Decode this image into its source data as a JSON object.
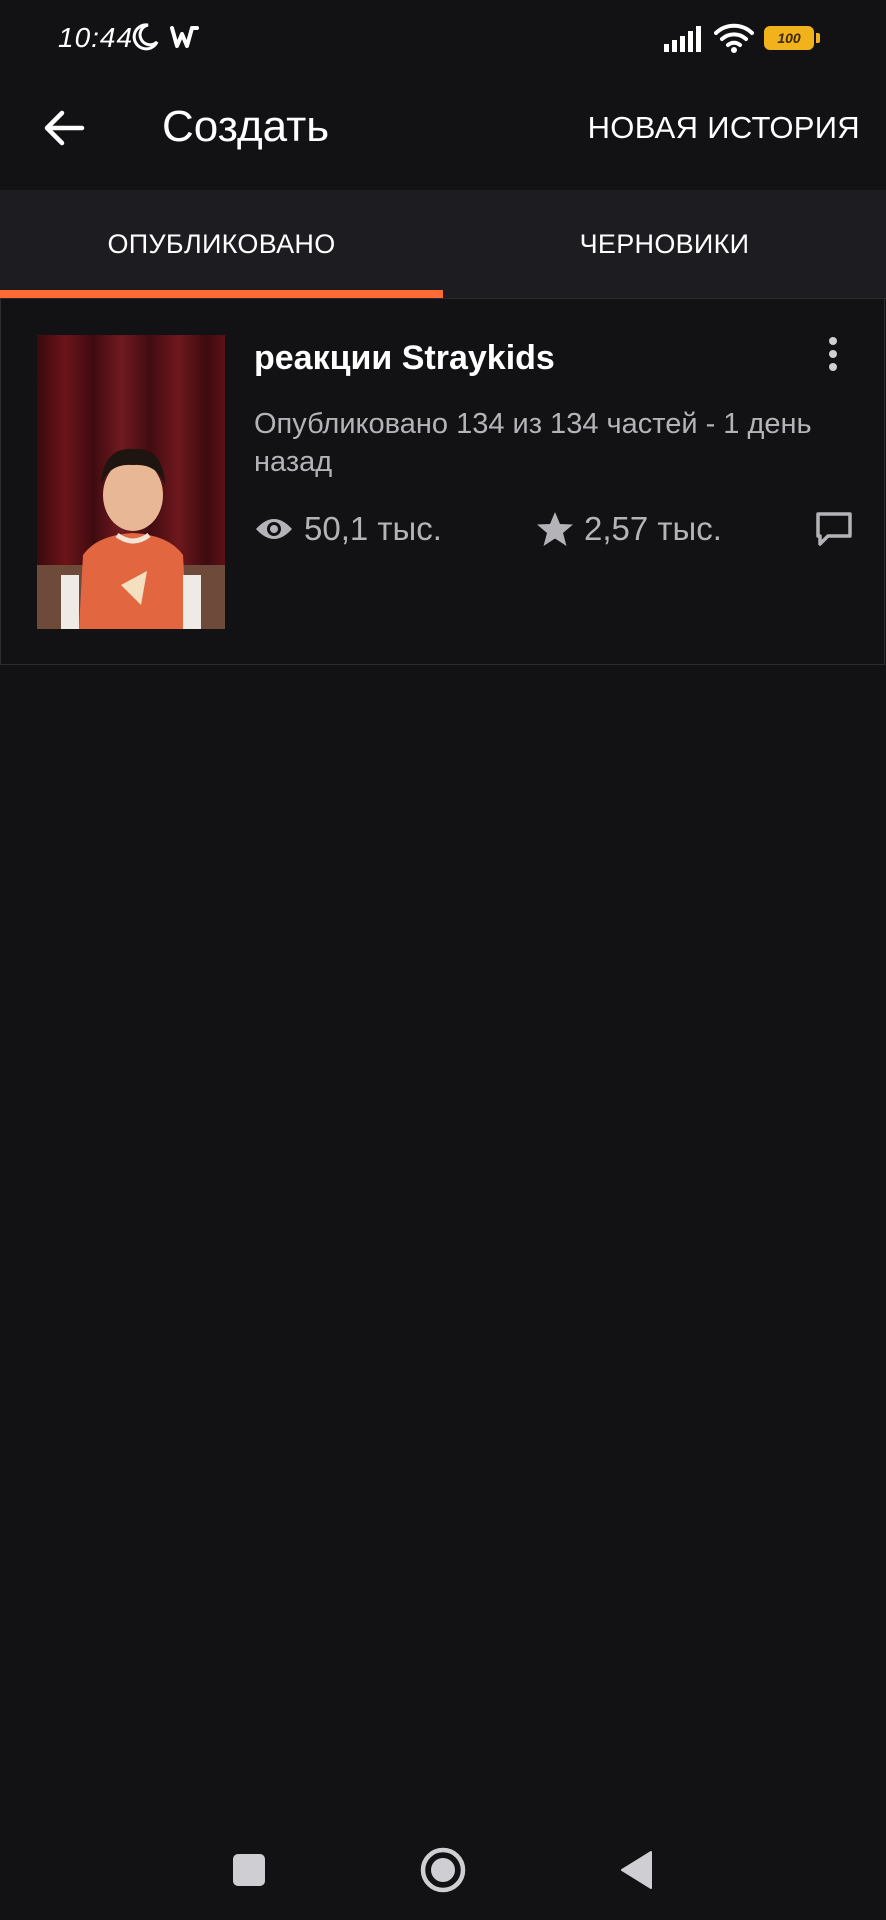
{
  "status_bar": {
    "time": "10:44",
    "battery": "100"
  },
  "app_bar": {
    "title": "Создать",
    "new_story_label": "НОВАЯ ИСТОРИЯ"
  },
  "tabs": [
    {
      "label": "ОПУБЛИКОВАНО",
      "selected": true
    },
    {
      "label": "ЧЕРНОВИКИ",
      "selected": false
    }
  ],
  "colors": {
    "accent": "#ff6b35",
    "background": "#121114",
    "tab_bar": "#1d1c20",
    "battery": "#f2b21b"
  },
  "stories": [
    {
      "title": "реакции Straykids",
      "status": "Опубликовано 134 из 134 частей - 1 день назад",
      "reads": "50,1 тыс.",
      "votes": "2,57 тыс.",
      "icons": {
        "reads": "eye-icon",
        "votes": "star-icon",
        "comments": "comment-icon",
        "more": "more-vert-icon"
      }
    }
  ],
  "nav_bar": {
    "icons": [
      "square-recents-icon",
      "circle-home-icon",
      "triangle-back-icon"
    ]
  }
}
